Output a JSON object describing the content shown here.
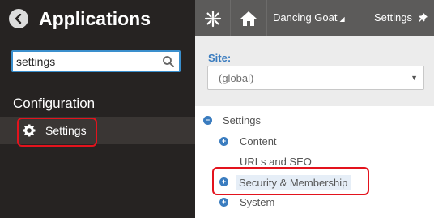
{
  "app_panel": {
    "title": "Applications",
    "search": {
      "value": "settings",
      "placeholder": ""
    },
    "section_title": "Configuration",
    "result_item": {
      "label": "Settings",
      "icon": "gear-icon"
    }
  },
  "topbar": {
    "site_menu": "Dancing Goat",
    "app_menu": "Settings",
    "icons": [
      "kentico-logo-icon",
      "home-icon",
      "pin-icon"
    ]
  },
  "site_selector": {
    "label": "Site:",
    "value": "(global)"
  },
  "tree": {
    "root": "Settings",
    "children": [
      {
        "label": "Content",
        "expandable": true
      },
      {
        "label": "URLs and SEO",
        "expandable": false
      },
      {
        "label": "Security & Membership",
        "expandable": true,
        "selected": true
      },
      {
        "label": "System",
        "expandable": true
      }
    ]
  },
  "colors": {
    "accent": "#3a7cbf",
    "highlight": "#e3131d",
    "panel_bg": "#262322",
    "topbar_bg": "#5c5b5a"
  }
}
